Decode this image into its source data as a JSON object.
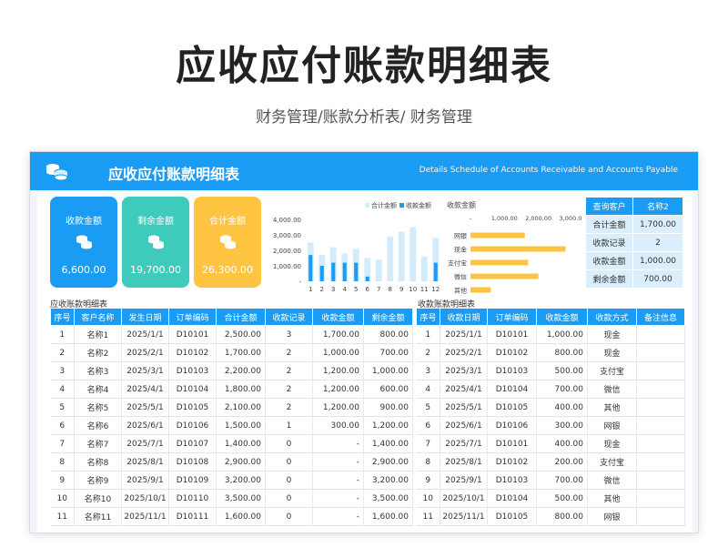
{
  "page": {
    "title": "应收应付账款明细表",
    "subtitle": "财务管理/账款分析表/ 财务管理"
  },
  "sheet": {
    "title": "应收应付账款明细表",
    "title_en": "Details Schedule of Accounts Receivable and Accounts Payable"
  },
  "cards": [
    {
      "label": "收款金额",
      "value": "6,600.00",
      "color": "#1b9cf4",
      "icon": "coins-icon"
    },
    {
      "label": "剩余金额",
      "value": "19,700.00",
      "color": "#3fcbbb",
      "icon": "coins-icon"
    },
    {
      "label": "合计金额",
      "value": "26,300.00",
      "color": "#ffc542",
      "icon": "coins-icon"
    }
  ],
  "summary": {
    "rows": [
      {
        "label": "查询客户",
        "value": "名称2"
      },
      {
        "label": "合计金额",
        "value": "1,700.00"
      },
      {
        "label": "收款记录",
        "value": "2"
      },
      {
        "label": "收款金额",
        "value": "1,000.00"
      },
      {
        "label": "剩余金额",
        "value": "700.00"
      }
    ]
  },
  "chart_data": [
    {
      "type": "bar",
      "legend_position": "top-right",
      "categories": [
        "1",
        "2",
        "3",
        "4",
        "5",
        "6",
        "7",
        "8",
        "9",
        "10",
        "11",
        "12"
      ],
      "series": [
        {
          "name": "合计金额",
          "color": "#d3ebfb",
          "values": [
            2500,
            1700,
            2200,
            1800,
            2100,
            1500,
            1400,
            2900,
            3200,
            3500,
            1600,
            2800
          ]
        },
        {
          "name": "收款金额",
          "color": "#1b9cf4",
          "values": [
            1700,
            1000,
            1200,
            1200,
            1200,
            300,
            0,
            0,
            0,
            0,
            0,
            1200
          ]
        }
      ],
      "ylim": [
        0,
        4000
      ],
      "yticks": [
        "4,000.00",
        "3,000.00",
        "2,000.00",
        "1,000.00",
        "-"
      ]
    },
    {
      "type": "bar",
      "orientation": "horizontal",
      "title": "收款金额",
      "categories": [
        "网银",
        "现金",
        "支付宝",
        "微信",
        "其他"
      ],
      "values": [
        1600,
        2800,
        1700,
        2000,
        600
      ],
      "color": "#ffc542",
      "xlim": [
        0,
        3000
      ],
      "xticks": [
        "-",
        "1,000.00",
        "2,000.00",
        "3,000.00"
      ]
    }
  ],
  "receivable": {
    "label": "应收账款明细表",
    "columns": [
      "序号",
      "客户名称",
      "发生日期",
      "订单编码",
      "合计金额",
      "收款记录",
      "收款金额",
      "剩余金额"
    ],
    "rows": [
      [
        "1",
        "名称1",
        "2025/1/1",
        "D10101",
        "2,500.00",
        "3",
        "1,700.00",
        "800.00"
      ],
      [
        "2",
        "名称2",
        "2025/2/1",
        "D10102",
        "1,700.00",
        "2",
        "1,000.00",
        "700.00"
      ],
      [
        "3",
        "名称3",
        "2025/3/1",
        "D10103",
        "2,200.00",
        "2",
        "1,200.00",
        "1,000.00"
      ],
      [
        "4",
        "名称4",
        "2025/4/1",
        "D10104",
        "1,800.00",
        "2",
        "1,200.00",
        "600.00"
      ],
      [
        "5",
        "名称5",
        "2025/5/1",
        "D10105",
        "2,100.00",
        "2",
        "1,200.00",
        "900.00"
      ],
      [
        "6",
        "名称6",
        "2025/6/1",
        "D10106",
        "1,500.00",
        "1",
        "300.00",
        "1,200.00"
      ],
      [
        "7",
        "名称7",
        "2025/7/1",
        "D10107",
        "1,400.00",
        "0",
        "-",
        "1,400.00"
      ],
      [
        "8",
        "名称8",
        "2025/8/1",
        "D10108",
        "2,900.00",
        "0",
        "-",
        "2,900.00"
      ],
      [
        "9",
        "名称9",
        "2025/9/1",
        "D10109",
        "3,200.00",
        "0",
        "-",
        "3,200.00"
      ],
      [
        "10",
        "名称10",
        "2025/10/1",
        "D10110",
        "3,500.00",
        "0",
        "-",
        "3,500.00"
      ],
      [
        "11",
        "名称11",
        "2025/11/1",
        "D10111",
        "1,600.00",
        "0",
        "-",
        "1,600.00"
      ]
    ]
  },
  "payments": {
    "label": "收款账款明细表",
    "columns": [
      "序号",
      "收款日期",
      "订单编码",
      "收款金额",
      "收款方式",
      "备注信息"
    ],
    "rows": [
      [
        "1",
        "2025/1/1",
        "D10101",
        "1,000.00",
        "现金",
        ""
      ],
      [
        "2",
        "2025/2/1",
        "D10102",
        "800.00",
        "现金",
        ""
      ],
      [
        "3",
        "2025/3/1",
        "D10103",
        "500.00",
        "支付宝",
        ""
      ],
      [
        "4",
        "2025/4/1",
        "D10104",
        "700.00",
        "微信",
        ""
      ],
      [
        "5",
        "2025/5/1",
        "D10105",
        "400.00",
        "其他",
        ""
      ],
      [
        "6",
        "2025/6/1",
        "D10106",
        "300.00",
        "网银",
        ""
      ],
      [
        "7",
        "2025/7/1",
        "D10101",
        "400.00",
        "现金",
        ""
      ],
      [
        "8",
        "2025/8/1",
        "D10102",
        "200.00",
        "支付宝",
        ""
      ],
      [
        "9",
        "2025/9/1",
        "D10103",
        "700.00",
        "微信",
        ""
      ],
      [
        "10",
        "2025/10/1",
        "D10104",
        "500.00",
        "其他",
        ""
      ],
      [
        "11",
        "2025/11/1",
        "D10105",
        "800.00",
        "网银",
        ""
      ]
    ]
  }
}
